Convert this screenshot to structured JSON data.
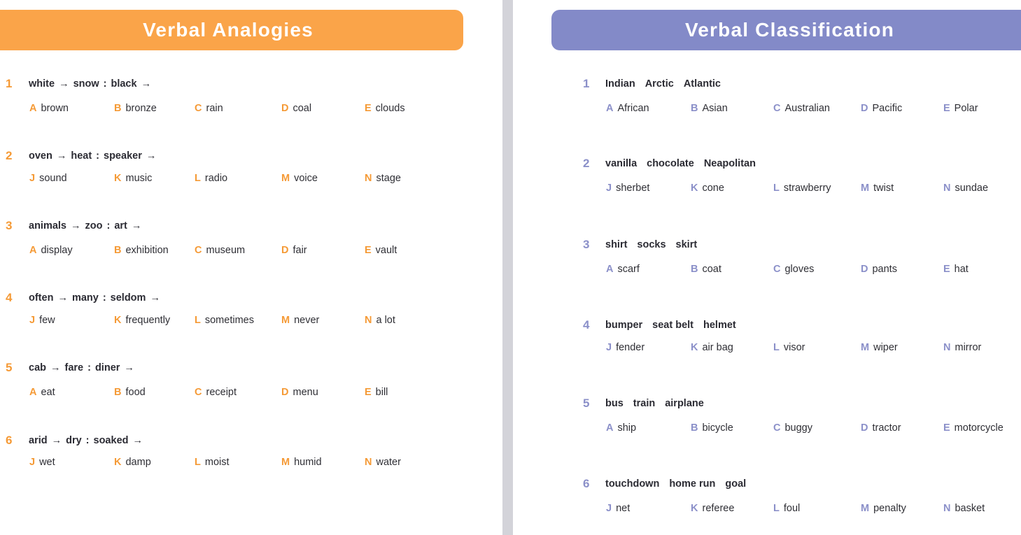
{
  "colors": {
    "orange_banner": "#faa449",
    "purple_banner": "#838ac8",
    "orange_accent": "#f59a36",
    "purple_accent": "#8b90c9",
    "stem_text": "#2b2b33",
    "option_text": "#2f2f35",
    "divider": "#d3d3d9",
    "page_background": "#ffffff"
  },
  "left_panel": {
    "title": "Verbal Analogies",
    "questions": [
      {
        "number": "1",
        "stem_parts": [
          "white",
          "→",
          "snow",
          ":",
          "black",
          "→"
        ],
        "stem_text": "white → snow : black →",
        "options": [
          {
            "letter": "A",
            "text": "brown"
          },
          {
            "letter": "B",
            "text": "bronze"
          },
          {
            "letter": "C",
            "text": "rain"
          },
          {
            "letter": "D",
            "text": "coal"
          },
          {
            "letter": "E",
            "text": "clouds"
          }
        ]
      },
      {
        "number": "2",
        "stem_parts": [
          "oven",
          "→",
          "heat",
          ":",
          "speaker",
          "→"
        ],
        "stem_text": "oven → heat : speaker →",
        "options": [
          {
            "letter": "J",
            "text": "sound"
          },
          {
            "letter": "K",
            "text": "music"
          },
          {
            "letter": "L",
            "text": "radio"
          },
          {
            "letter": "M",
            "text": "voice"
          },
          {
            "letter": "N",
            "text": "stage"
          }
        ]
      },
      {
        "number": "3",
        "stem_parts": [
          "animals",
          "→",
          "zoo",
          ":",
          "art",
          "→"
        ],
        "stem_text": "animals → zoo : art →",
        "options": [
          {
            "letter": "A",
            "text": "display"
          },
          {
            "letter": "B",
            "text": "exhibition"
          },
          {
            "letter": "C",
            "text": "museum"
          },
          {
            "letter": "D",
            "text": "fair"
          },
          {
            "letter": "E",
            "text": "vault"
          }
        ]
      },
      {
        "number": "4",
        "stem_parts": [
          "often",
          "→",
          "many",
          ":",
          "seldom",
          "→"
        ],
        "stem_text": "often → many : seldom →",
        "options": [
          {
            "letter": "J",
            "text": "few"
          },
          {
            "letter": "K",
            "text": "frequently"
          },
          {
            "letter": "L",
            "text": "sometimes"
          },
          {
            "letter": "M",
            "text": "never"
          },
          {
            "letter": "N",
            "text": "a lot"
          }
        ]
      },
      {
        "number": "5",
        "stem_parts": [
          "cab",
          "→",
          "fare",
          ":",
          "diner",
          "→"
        ],
        "stem_text": "cab → fare : diner →",
        "options": [
          {
            "letter": "A",
            "text": "eat"
          },
          {
            "letter": "B",
            "text": "food"
          },
          {
            "letter": "C",
            "text": "receipt"
          },
          {
            "letter": "D",
            "text": "menu"
          },
          {
            "letter": "E",
            "text": "bill"
          }
        ]
      },
      {
        "number": "6",
        "stem_parts": [
          "arid",
          "→",
          "dry",
          ":",
          "soaked",
          "→"
        ],
        "stem_text": "arid → dry : soaked →",
        "options": [
          {
            "letter": "J",
            "text": "wet"
          },
          {
            "letter": "K",
            "text": "damp"
          },
          {
            "letter": "L",
            "text": "moist"
          },
          {
            "letter": "M",
            "text": "humid"
          },
          {
            "letter": "N",
            "text": "water"
          }
        ]
      }
    ]
  },
  "right_panel": {
    "title": "Verbal Classification",
    "questions": [
      {
        "number": "1",
        "stem_parts": [
          "Indian",
          "Arctic",
          "Atlantic"
        ],
        "stem_text": "Indian   Arctic   Atlantic",
        "options": [
          {
            "letter": "A",
            "text": "African"
          },
          {
            "letter": "B",
            "text": "Asian"
          },
          {
            "letter": "C",
            "text": "Australian"
          },
          {
            "letter": "D",
            "text": "Pacific"
          },
          {
            "letter": "E",
            "text": "Polar"
          }
        ]
      },
      {
        "number": "2",
        "stem_parts": [
          "vanilla",
          "chocolate",
          "Neapolitan"
        ],
        "stem_text": "vanilla   chocolate   Neapolitan",
        "options": [
          {
            "letter": "J",
            "text": "sherbet"
          },
          {
            "letter": "K",
            "text": "cone"
          },
          {
            "letter": "L",
            "text": "strawberry"
          },
          {
            "letter": "M",
            "text": "twist"
          },
          {
            "letter": "N",
            "text": "sundae"
          }
        ]
      },
      {
        "number": "3",
        "stem_parts": [
          "shirt",
          "socks",
          "skirt"
        ],
        "stem_text": "shirt   socks   skirt",
        "options": [
          {
            "letter": "A",
            "text": "scarf"
          },
          {
            "letter": "B",
            "text": "coat"
          },
          {
            "letter": "C",
            "text": "gloves"
          },
          {
            "letter": "D",
            "text": "pants"
          },
          {
            "letter": "E",
            "text": "hat"
          }
        ]
      },
      {
        "number": "4",
        "stem_parts": [
          "bumper",
          "seat belt",
          "helmet"
        ],
        "stem_text": "bumper   seat belt   helmet",
        "options": [
          {
            "letter": "J",
            "text": "fender"
          },
          {
            "letter": "K",
            "text": "air bag"
          },
          {
            "letter": "L",
            "text": "visor"
          },
          {
            "letter": "M",
            "text": "wiper"
          },
          {
            "letter": "N",
            "text": "mirror"
          }
        ]
      },
      {
        "number": "5",
        "stem_parts": [
          "bus",
          "train",
          "airplane"
        ],
        "stem_text": "bus   train   airplane",
        "options": [
          {
            "letter": "A",
            "text": "ship"
          },
          {
            "letter": "B",
            "text": "bicycle"
          },
          {
            "letter": "C",
            "text": "buggy"
          },
          {
            "letter": "D",
            "text": "tractor"
          },
          {
            "letter": "E",
            "text": "motorcycle"
          }
        ]
      },
      {
        "number": "6",
        "stem_parts": [
          "touchdown",
          "home run",
          "goal"
        ],
        "stem_text": "touchdown   home run   goal",
        "options": [
          {
            "letter": "J",
            "text": "net"
          },
          {
            "letter": "K",
            "text": "referee"
          },
          {
            "letter": "L",
            "text": "foul"
          },
          {
            "letter": "M",
            "text": "penalty"
          },
          {
            "letter": "N",
            "text": "basket"
          }
        ]
      }
    ]
  }
}
